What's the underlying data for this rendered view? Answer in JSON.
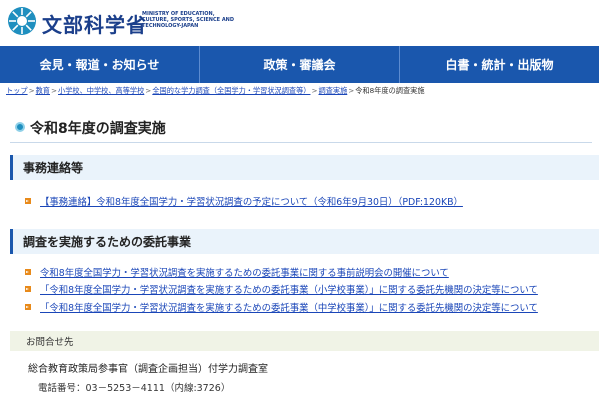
{
  "header": {
    "logo_jp": "文部科学省",
    "logo_en": "MINISTRY OF EDUCATION, CULTURE, SPORTS, SCIENCE AND TECHNOLOGY-JAPAN",
    "brand_color": "#1a57ad",
    "icon": "mext-logo-icon"
  },
  "nav": {
    "items": [
      {
        "label": "会見・報道・お知らせ"
      },
      {
        "label": "政策・審議会"
      },
      {
        "label": "白書・統計・出版物"
      }
    ]
  },
  "breadcrumb": {
    "items": [
      "トップ",
      "教育",
      "小学校、中学校、高等学校",
      "全国的な学力調査（全国学力・学習状況調査等）",
      "調査実施"
    ],
    "current": "令和8年度の調査実施",
    "separator": ">"
  },
  "page": {
    "title": "令和8年度の調査実施"
  },
  "sections": [
    {
      "heading": "事務連絡等",
      "links": [
        "【事務連絡】令和8年度全国学力・学習状況調査の予定について（令和6年9月30日）（PDF:120KB）"
      ]
    },
    {
      "heading": "調査を実施するための委託事業",
      "links": [
        "令和8年度全国学力・学習状況調査を実施するための委託事業に関する事前説明会の開催について",
        "「令和8年度全国学力・学習状況調査を実施するための委託事業（小学校事業）」に関する委託先機関の決定等について",
        "「令和8年度全国学力・学習状況調査を実施するための委託事業（中学校事業）」に関する委託先機関の決定等について"
      ]
    }
  ],
  "contact": {
    "heading": "お問合せ先",
    "org": "総合教育政策局参事官（調査企画担当）付学力調査室",
    "tel": "電話番号：03－5253－4111（内線:3726）"
  },
  "colors": {
    "link": "#1a46b8",
    "bullet": "#e88a1a",
    "section_bg": "#eaf3fb"
  }
}
